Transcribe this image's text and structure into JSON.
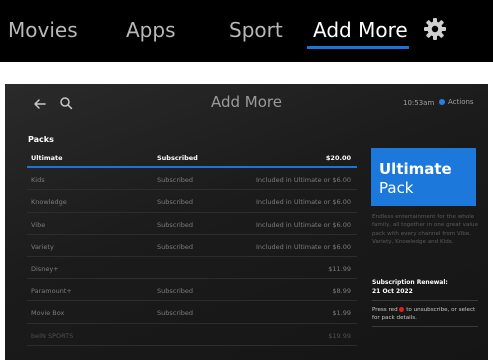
{
  "nav": {
    "items": [
      "Movies",
      "Apps",
      "Sport",
      "Add More"
    ],
    "active": "Add More",
    "settings_icon": "gear-icon"
  },
  "header": {
    "title": "Add More",
    "time": "10:53am",
    "actions_label": "Actions",
    "back_icon": "back-arrow-icon",
    "search_icon": "search-icon"
  },
  "packs": {
    "label": "Packs",
    "rows": [
      {
        "name": "Ultimate",
        "status": "Subscribed",
        "price": "$20.00"
      },
      {
        "name": "Kids",
        "status": "Subscribed",
        "price": "Included in Ultimate or $6.00"
      },
      {
        "name": "Knowledge",
        "status": "Subscribed",
        "price": "Included in Ultimate or $6.00"
      },
      {
        "name": "Vibe",
        "status": "Subscribed",
        "price": "Included in Ultimate or $6.00"
      },
      {
        "name": "Variety",
        "status": "Subscribed",
        "price": "Included in Ultimate or $6.00"
      },
      {
        "name": "Disney+",
        "status": "",
        "price": "$11.99"
      },
      {
        "name": "Paramount+",
        "status": "Subscribed",
        "price": "$8.99"
      },
      {
        "name": "Movie Box",
        "status": "Subscribed",
        "price": "$1.99"
      },
      {
        "name": "beIN SPORTS",
        "status": "",
        "price": "$19.99"
      }
    ]
  },
  "detail": {
    "title_line1": "Ultimate",
    "title_line2": "Pack",
    "description": "Endless entertainment for the whole family, all together in one great value pack with every channel from Vibe, Variety, Knowledge and Kids.",
    "renewal_label": "Subscription Renewal:",
    "renewal_date": "21 Oct 2022",
    "hint_pre": "Press red",
    "hint_post": "to unsubscribe, or select for pack details."
  },
  "colors": {
    "accent": "#1e73d8",
    "red_button": "#e0211b"
  }
}
